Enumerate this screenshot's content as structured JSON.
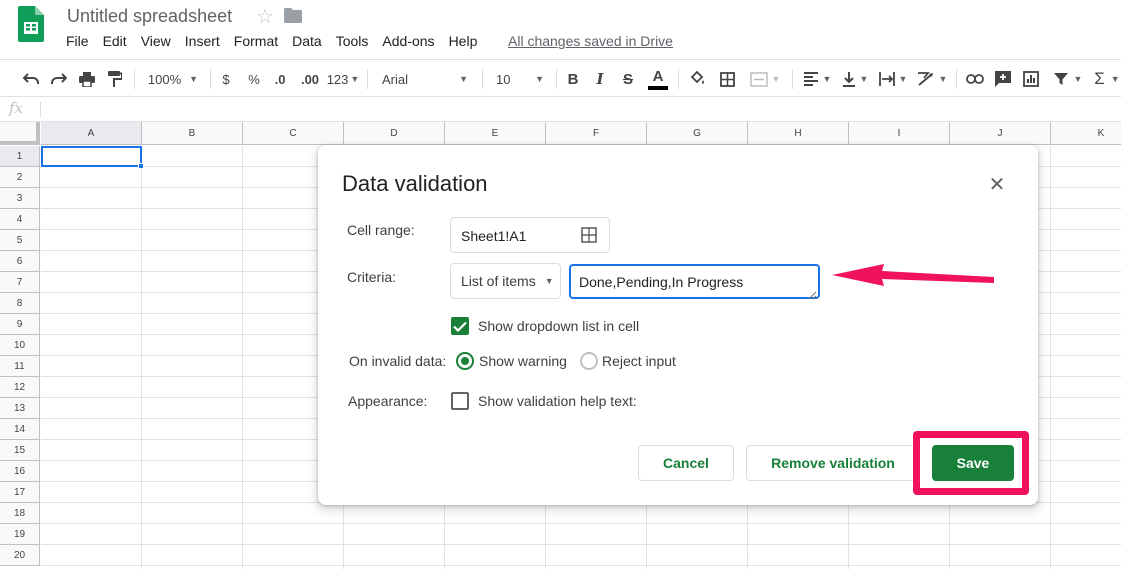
{
  "app": {
    "doc_title": "Untitled spreadsheet",
    "save_status": "All changes saved in Drive",
    "menu": [
      "File",
      "Edit",
      "View",
      "Insert",
      "Format",
      "Data",
      "Tools",
      "Add-ons",
      "Help"
    ],
    "icons": {
      "logo": "sheets-logo-icon",
      "star": "star-icon",
      "folder": "folder-icon"
    },
    "brand_color": "#0f9d58"
  },
  "toolbar": {
    "zoom": "100%",
    "currency": "$",
    "percent": "%",
    "decrease_decimals": ".0",
    "increase_decimals": ".00",
    "more_formats": "123",
    "font": "Arial",
    "font_size": "10",
    "bold": "B",
    "italic": "I",
    "strikethrough": "S",
    "text_color": "A",
    "functions": "Σ"
  },
  "formula_bar": {
    "fx_label": "fx"
  },
  "grid": {
    "columns": [
      "A",
      "B",
      "C",
      "D",
      "E",
      "F",
      "G",
      "H",
      "I",
      "J",
      "K"
    ],
    "rows": [
      "1",
      "2",
      "3",
      "4",
      "5",
      "6",
      "7",
      "8",
      "9",
      "10",
      "11",
      "12",
      "13",
      "14",
      "15",
      "16",
      "17",
      "18",
      "19",
      "20"
    ],
    "active_cell": "A1"
  },
  "dialog": {
    "title": "Data validation",
    "close_icon": "close-icon",
    "cell_range_label": "Cell range:",
    "cell_range_value": "Sheet1!A1",
    "criteria_label": "Criteria:",
    "criteria_type": "List of items",
    "criteria_value": "Done,Pending,In Progress",
    "show_dropdown_label": "Show dropdown list in cell",
    "show_dropdown_checked": true,
    "invalid_label": "On invalid data:",
    "invalid_options": [
      {
        "label": "Show warning",
        "selected": true
      },
      {
        "label": "Reject input",
        "selected": false
      }
    ],
    "appearance_label": "Appearance:",
    "help_text_label": "Show validation help text:",
    "help_text_checked": false,
    "buttons": {
      "cancel": "Cancel",
      "remove": "Remove validation",
      "save": "Save"
    },
    "accent_color": "#188038"
  },
  "annotations": {
    "highlight_color": "#f0125e"
  }
}
